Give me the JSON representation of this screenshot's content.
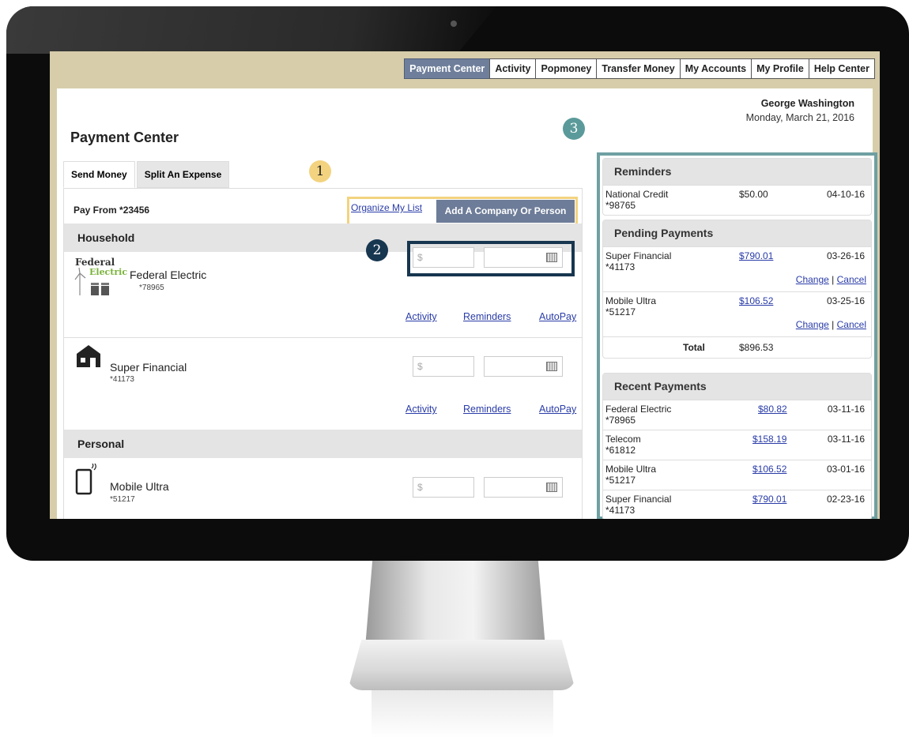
{
  "nav": {
    "tabs": [
      "Payment Center",
      "Activity",
      "Popmoney",
      "Transfer Money",
      "My Accounts",
      "My Profile",
      "Help Center"
    ]
  },
  "user": {
    "name": "George Washington",
    "date": "Monday, March 21, 2016"
  },
  "page": {
    "title": "Payment Center"
  },
  "tabs": [
    "Send Money",
    "Split An Expense"
  ],
  "pay_from": "Pay From *23456",
  "actions": {
    "organize": "Organize My List",
    "add": "Add A Company Or Person"
  },
  "sections": [
    {
      "title": "Household",
      "payees": [
        {
          "name": "Federal Electric",
          "account": "*78965",
          "logo_line1": "Federal",
          "logo_line2": "Electric"
        },
        {
          "name": "Super Financial",
          "account": "*41173"
        }
      ]
    },
    {
      "title": "Personal",
      "payees": [
        {
          "name": "Mobile Ultra",
          "account": "*51217"
        }
      ]
    }
  ],
  "row_links": {
    "activity": "Activity",
    "reminders": "Reminders",
    "autopay": "AutoPay"
  },
  "amount_placeholder": "$",
  "badges": [
    "1",
    "2",
    "3"
  ],
  "reminders": {
    "title": "Reminders",
    "items": [
      {
        "name": "National Credit",
        "account": "*98765",
        "amount": "$50.00",
        "date": "04-10-16"
      }
    ]
  },
  "pending": {
    "title": "Pending Payments",
    "items": [
      {
        "name": "Super Financial",
        "account": "*41173",
        "amount": "$790.01",
        "date": "03-26-16"
      },
      {
        "name": "Mobile Ultra",
        "account": "*51217",
        "amount": "$106.52",
        "date": "03-25-16"
      }
    ],
    "change": "Change",
    "separator": "|",
    "cancel": "Cancel",
    "total_label": "Total",
    "total": "$896.53"
  },
  "recent": {
    "title": "Recent Payments",
    "items": [
      {
        "name": "Federal Electric",
        "account": "*78965",
        "amount": "$80.82",
        "date": "03-11-16"
      },
      {
        "name": "Telecom",
        "account": "*61812",
        "amount": "$158.19",
        "date": "03-11-16"
      },
      {
        "name": "Mobile Ultra",
        "account": "*51217",
        "amount": "$106.52",
        "date": "03-01-16"
      },
      {
        "name": "Super Financial",
        "account": "*41173",
        "amount": "$790.01",
        "date": "02-23-16"
      }
    ]
  },
  "colors": {
    "accent": "#6d7c98",
    "callout1": "#f3d37f",
    "callout2": "#17364f",
    "callout3": "#6fa0a2",
    "link": "#2a3ca8"
  }
}
